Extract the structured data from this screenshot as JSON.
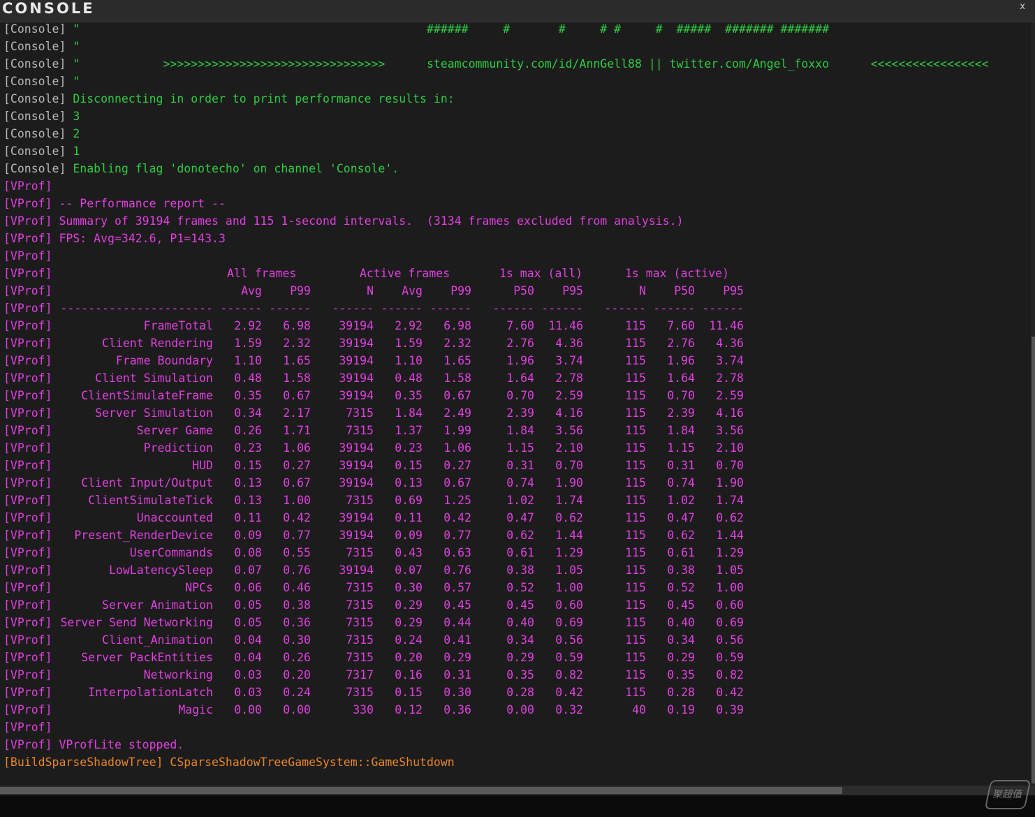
{
  "window": {
    "title": "CONSOLE",
    "close_label": "x"
  },
  "colors": {
    "console": "#2ecc40",
    "vprof": "#e040e0",
    "build": "#e8852a",
    "tag": "#b8b8b8",
    "background": "#1c1c1c"
  },
  "log": {
    "pre": [
      {
        "tag": "[Console]",
        "text": " \"                                                  ######     #       #     # #     #  #####  ####### #######"
      },
      {
        "tag": "[Console]",
        "text": " \""
      },
      {
        "tag": "[Console]",
        "text": " \"            >>>>>>>>>>>>>>>>>>>>>>>>>>>>>>>>      steamcommunity.com/id/AnnGell88 || twitter.com/Angel_foxxo      <<<<<<<<<<<<<<<<<"
      },
      {
        "tag": "[Console]",
        "text": " \""
      },
      {
        "tag": "[Console]",
        "text": " Disconnecting in order to print performance results in:"
      },
      {
        "tag": "[Console]",
        "text": " 3"
      },
      {
        "tag": "[Console]",
        "text": " 2"
      },
      {
        "tag": "[Console]",
        "text": " 1"
      },
      {
        "tag": "[Console]",
        "text": " Enabling flag 'donotecho' on channel 'Console'."
      },
      {
        "tag": "[VProf]",
        "text": ""
      },
      {
        "tag": "[VProf]",
        "text": " -- Performance report --"
      },
      {
        "tag": "[VProf]",
        "text": " Summary of 39194 frames and 115 1-second intervals.  (3134 frames excluded from analysis.)"
      },
      {
        "tag": "[VProf]",
        "text": " FPS: Avg=342.6, P1=143.3"
      },
      {
        "tag": "[VProf]",
        "text": ""
      }
    ],
    "header1": {
      "tag": "[VProf]",
      "groups": [
        "All frames",
        "Active frames",
        "1s max (all)",
        "1s max (active)"
      ]
    },
    "header2": {
      "tag": "[VProf]",
      "cols": [
        "Avg",
        "P99",
        "N",
        "Avg",
        "P99",
        "P50",
        "P95",
        "N",
        "P50",
        "P95"
      ]
    },
    "separator": {
      "tag": "[VProf]",
      "name": "----------------------",
      "dashes": [
        "------",
        "------",
        "------",
        "------",
        "------",
        "------",
        "------",
        "------",
        "------",
        "------"
      ]
    },
    "rows": [
      {
        "name": "FrameTotal",
        "values": [
          "2.92",
          "6.98",
          "39194",
          "2.92",
          "6.98",
          "7.60",
          "11.46",
          "115",
          "7.60",
          "11.46"
        ]
      },
      {
        "name": "Client Rendering",
        "values": [
          "1.59",
          "2.32",
          "39194",
          "1.59",
          "2.32",
          "2.76",
          "4.36",
          "115",
          "2.76",
          "4.36"
        ]
      },
      {
        "name": "Frame Boundary",
        "values": [
          "1.10",
          "1.65",
          "39194",
          "1.10",
          "1.65",
          "1.96",
          "3.74",
          "115",
          "1.96",
          "3.74"
        ]
      },
      {
        "name": "Client Simulation",
        "values": [
          "0.48",
          "1.58",
          "39194",
          "0.48",
          "1.58",
          "1.64",
          "2.78",
          "115",
          "1.64",
          "2.78"
        ]
      },
      {
        "name": "ClientSimulateFrame",
        "values": [
          "0.35",
          "0.67",
          "39194",
          "0.35",
          "0.67",
          "0.70",
          "2.59",
          "115",
          "0.70",
          "2.59"
        ]
      },
      {
        "name": "Server Simulation",
        "values": [
          "0.34",
          "2.17",
          "7315",
          "1.84",
          "2.49",
          "2.39",
          "4.16",
          "115",
          "2.39",
          "4.16"
        ]
      },
      {
        "name": "Server Game",
        "values": [
          "0.26",
          "1.71",
          "7315",
          "1.37",
          "1.99",
          "1.84",
          "3.56",
          "115",
          "1.84",
          "3.56"
        ]
      },
      {
        "name": "Prediction",
        "values": [
          "0.23",
          "1.06",
          "39194",
          "0.23",
          "1.06",
          "1.15",
          "2.10",
          "115",
          "1.15",
          "2.10"
        ]
      },
      {
        "name": "HUD",
        "values": [
          "0.15",
          "0.27",
          "39194",
          "0.15",
          "0.27",
          "0.31",
          "0.70",
          "115",
          "0.31",
          "0.70"
        ]
      },
      {
        "name": "Client Input/Output",
        "values": [
          "0.13",
          "0.67",
          "39194",
          "0.13",
          "0.67",
          "0.74",
          "1.90",
          "115",
          "0.74",
          "1.90"
        ]
      },
      {
        "name": "ClientSimulateTick",
        "values": [
          "0.13",
          "1.00",
          "7315",
          "0.69",
          "1.25",
          "1.02",
          "1.74",
          "115",
          "1.02",
          "1.74"
        ]
      },
      {
        "name": "Unaccounted",
        "values": [
          "0.11",
          "0.42",
          "39194",
          "0.11",
          "0.42",
          "0.47",
          "0.62",
          "115",
          "0.47",
          "0.62"
        ]
      },
      {
        "name": "Present_RenderDevice",
        "values": [
          "0.09",
          "0.77",
          "39194",
          "0.09",
          "0.77",
          "0.62",
          "1.44",
          "115",
          "0.62",
          "1.44"
        ]
      },
      {
        "name": "UserCommands",
        "values": [
          "0.08",
          "0.55",
          "7315",
          "0.43",
          "0.63",
          "0.61",
          "1.29",
          "115",
          "0.61",
          "1.29"
        ]
      },
      {
        "name": "LowLatencySleep",
        "values": [
          "0.07",
          "0.76",
          "39194",
          "0.07",
          "0.76",
          "0.38",
          "1.05",
          "115",
          "0.38",
          "1.05"
        ]
      },
      {
        "name": "NPCs",
        "values": [
          "0.06",
          "0.46",
          "7315",
          "0.30",
          "0.57",
          "0.52",
          "1.00",
          "115",
          "0.52",
          "1.00"
        ]
      },
      {
        "name": "Server Animation",
        "values": [
          "0.05",
          "0.38",
          "7315",
          "0.29",
          "0.45",
          "0.45",
          "0.60",
          "115",
          "0.45",
          "0.60"
        ]
      },
      {
        "name": "Server Send Networking",
        "values": [
          "0.05",
          "0.36",
          "7315",
          "0.29",
          "0.44",
          "0.40",
          "0.69",
          "115",
          "0.40",
          "0.69"
        ]
      },
      {
        "name": "Client_Animation",
        "values": [
          "0.04",
          "0.30",
          "7315",
          "0.24",
          "0.41",
          "0.34",
          "0.56",
          "115",
          "0.34",
          "0.56"
        ]
      },
      {
        "name": "Server PackEntities",
        "values": [
          "0.04",
          "0.26",
          "7315",
          "0.20",
          "0.29",
          "0.29",
          "0.59",
          "115",
          "0.29",
          "0.59"
        ]
      },
      {
        "name": "Networking",
        "values": [
          "0.03",
          "0.20",
          "7317",
          "0.16",
          "0.31",
          "0.35",
          "0.82",
          "115",
          "0.35",
          "0.82"
        ]
      },
      {
        "name": "InterpolationLatch",
        "values": [
          "0.03",
          "0.24",
          "7315",
          "0.15",
          "0.30",
          "0.28",
          "0.42",
          "115",
          "0.28",
          "0.42"
        ]
      },
      {
        "name": "Magic",
        "values": [
          "0.00",
          "0.00",
          "330",
          "0.12",
          "0.36",
          "0.00",
          "0.32",
          "40",
          "0.19",
          "0.39"
        ]
      }
    ],
    "post": [
      {
        "tag": "[VProf]",
        "text": ""
      },
      {
        "tag": "[VProf]",
        "text": " VProfLite stopped."
      },
      {
        "tag": "[BuildSparseShadowTree]",
        "text": " CSparseShadowTreeGameSystem::GameShutdown"
      }
    ]
  },
  "watermark": {
    "text": "聚超值"
  }
}
